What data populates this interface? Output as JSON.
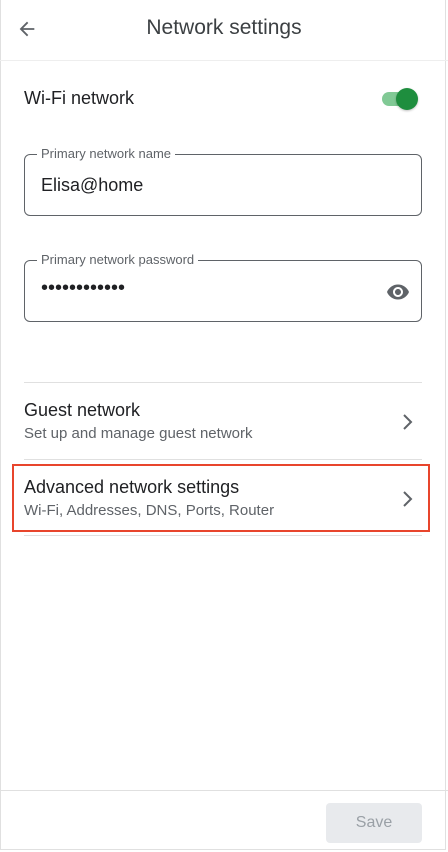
{
  "header": {
    "title": "Network settings",
    "back_icon": "arrow-left-icon"
  },
  "wifi": {
    "label": "Wi-Fi network",
    "enabled": true,
    "toggle_color": "#1e8e3e"
  },
  "primary_name": {
    "label": "Primary network name",
    "value": "Elisa@home"
  },
  "primary_password": {
    "label": "Primary network password",
    "value": "••••••••••••",
    "visibility_icon": "eye-icon"
  },
  "rows": [
    {
      "title": "Guest network",
      "subtitle": "Set up and manage guest network"
    },
    {
      "title": "Advanced network settings",
      "subtitle": "Wi-Fi, Addresses, DNS, Ports, Router"
    }
  ],
  "footer": {
    "save_label": "Save"
  },
  "colors": {
    "accent": "#1e8e3e",
    "highlight": "#e8452c"
  }
}
